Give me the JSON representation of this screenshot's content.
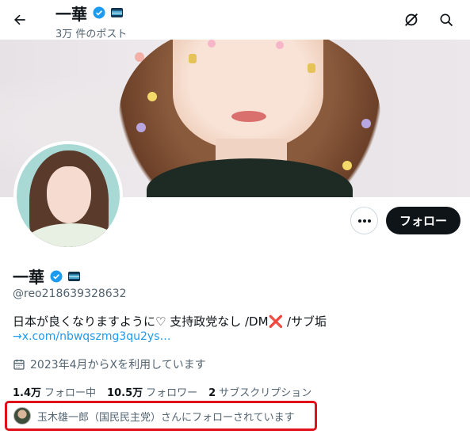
{
  "header": {
    "title": "一華",
    "post_count": "3万 件のポスト"
  },
  "profile": {
    "name": "一華",
    "handle": "@reo218639328632",
    "bio": "日本が良くなりますように♡ 支持政党なし /DM❌ /サブ垢",
    "bio_link": "→x.com/nbwqszmg3qu2ys…",
    "joined": "2023年4月からXを利用しています"
  },
  "actions": {
    "follow_label": "フォロー",
    "more_label": "•••"
  },
  "stats": {
    "following_count": "1.4万",
    "following_label": "フォロー中",
    "followers_count": "10.5万",
    "followers_label": "フォロワー",
    "subscriptions_count": "2",
    "subscriptions_label": "サブスクリプション"
  },
  "followed_by": {
    "text": "玉木雄一郎（国民民主党）さんにフォローされています"
  },
  "colors": {
    "accent": "#1d9bf0",
    "verified": "#1d9bf0",
    "highlight_border": "#e0101b",
    "follow_button": "#0f1419"
  },
  "icons": {
    "back": "arrow-left-icon",
    "grok": "circle-slash-icon",
    "search": "search-icon",
    "verified": "verified-badge-icon",
    "calendar": "calendar-icon"
  }
}
